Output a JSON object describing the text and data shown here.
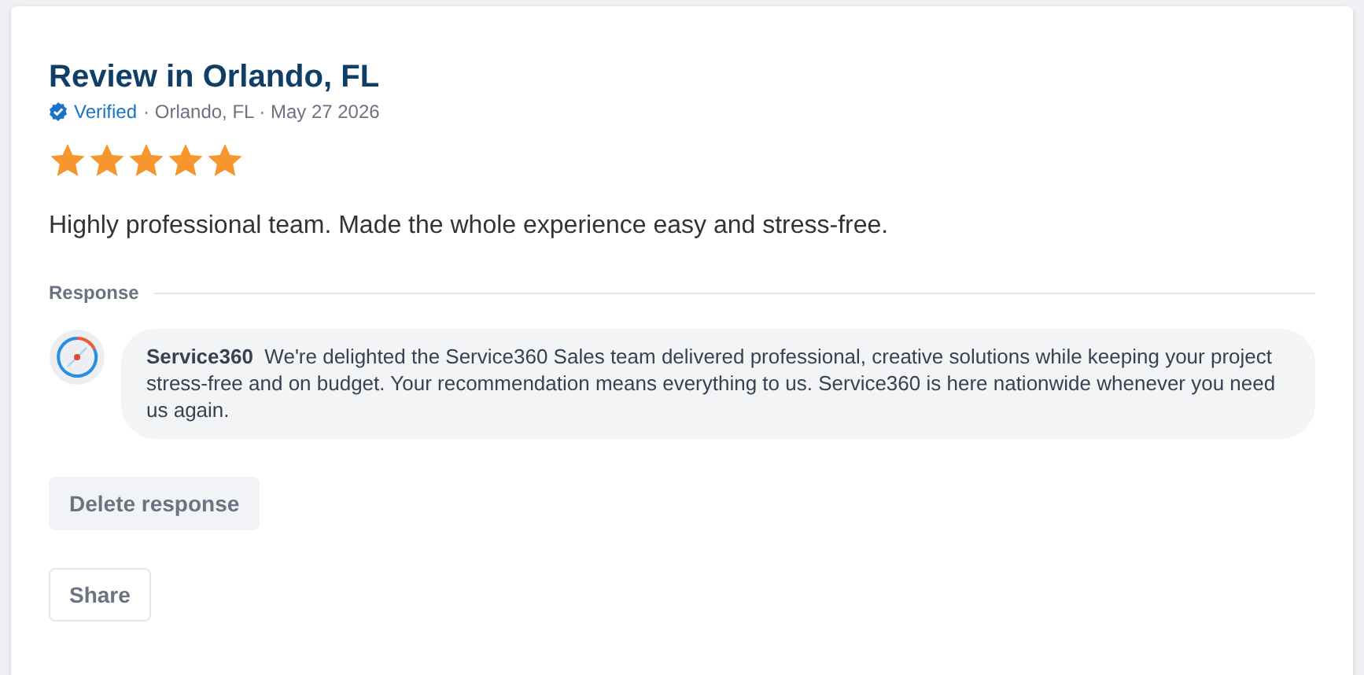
{
  "review": {
    "title": "Review in Orlando, FL",
    "verified": "Verified",
    "meta": "· Orlando, FL · May 27 2026",
    "stars": 5,
    "text": "Highly professional team. Made the whole experience easy and stress-free."
  },
  "response": {
    "heading": "Response",
    "message": "**Service360**  We're delighted the Service360 Sales team delivered professional, creative solutions while keeping your project stress-free and on budget. Your recommendation means everything to us. Service360 is here nationwide whenever you need us again."
  },
  "buttons": [
    {
      "label": "Delete response",
      "kind": "filled"
    },
    {
      "label": "Share",
      "kind": "outline"
    }
  ]
}
